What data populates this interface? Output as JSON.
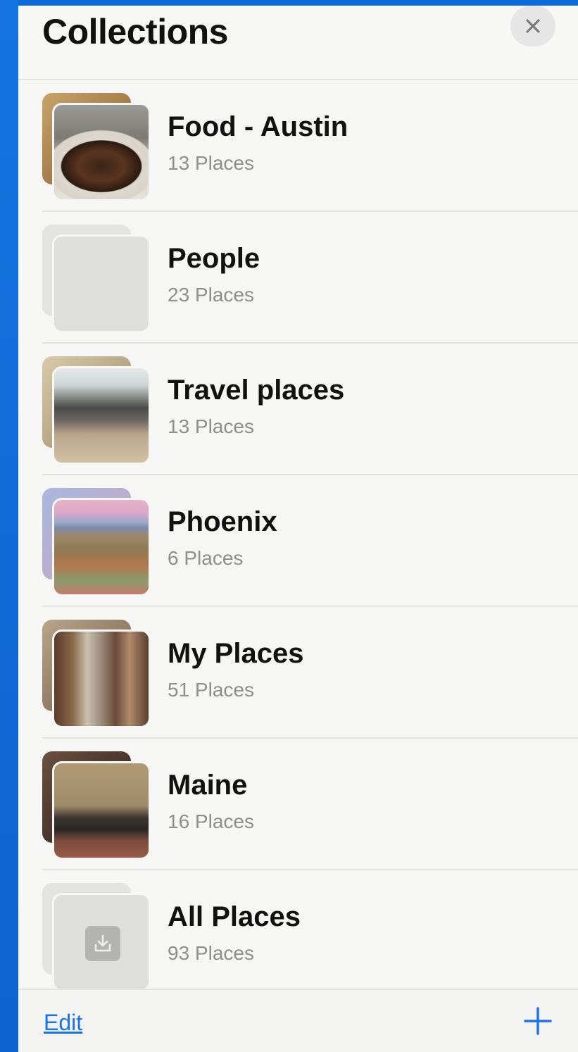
{
  "header": {
    "title": "Collections",
    "close_icon": "close-icon"
  },
  "collections": [
    {
      "name": "Food - Austin",
      "count": "13 Places",
      "thumbnail": "food-photo"
    },
    {
      "name": "People",
      "count": "23 Places",
      "thumbnail": "empty"
    },
    {
      "name": "Travel places",
      "count": "13 Places",
      "thumbnail": "cafe-interior-photo"
    },
    {
      "name": "Phoenix",
      "count": "6 Places",
      "thumbnail": "aerial-city-photo"
    },
    {
      "name": "My Places",
      "count": "51 Places",
      "thumbnail": "store-interior-photo"
    },
    {
      "name": "Maine",
      "count": "16 Places",
      "thumbnail": "living-room-photo"
    },
    {
      "name": "All Places",
      "count": "93 Places",
      "thumbnail": "download-icon"
    }
  ],
  "footer": {
    "edit_label": "Edit",
    "add_icon": "plus-icon"
  },
  "colors": {
    "accent": "#1a73e8",
    "frame": "#0b66d6"
  }
}
